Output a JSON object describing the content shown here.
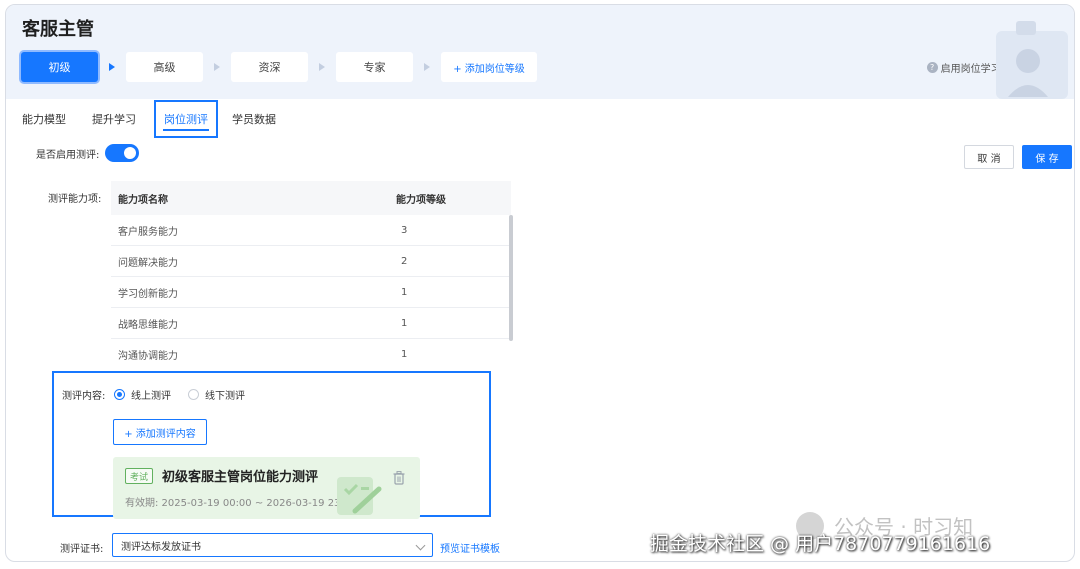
{
  "page": {
    "title": "客服主管"
  },
  "levels": {
    "items": [
      {
        "label": "初级",
        "active": true
      },
      {
        "label": "高级",
        "active": false
      },
      {
        "label": "资深",
        "active": false
      },
      {
        "label": "专家",
        "active": false
      }
    ],
    "add_label": "+ 添加岗位等级"
  },
  "learning_toggle": {
    "label": "启用岗位学习:",
    "enabled": true
  },
  "tabs": [
    {
      "label": "能力模型",
      "active": false
    },
    {
      "label": "提升学习",
      "active": false
    },
    {
      "label": "岗位测评",
      "active": true
    },
    {
      "label": "学员数据",
      "active": false
    }
  ],
  "assessment": {
    "enable_label": "是否启用测评:",
    "enabled": true,
    "cancel_label": "取 消",
    "save_label": "保 存",
    "ability_label": "测评能力项:",
    "table": {
      "headers": [
        "能力项名称",
        "能力项等级"
      ],
      "rows": [
        [
          "客户服务能力",
          "3"
        ],
        [
          "问题解决能力",
          "2"
        ],
        [
          "学习创新能力",
          "1"
        ],
        [
          "战略思维能力",
          "1"
        ],
        [
          "沟通协调能力",
          "1"
        ]
      ]
    },
    "content_label": "测评内容:",
    "modes": [
      {
        "label": "线上测评",
        "checked": true
      },
      {
        "label": "线下测评",
        "checked": false
      }
    ],
    "add_content_label": "+ 添加测评内容",
    "exam": {
      "tag": "考试",
      "title": "初级客服主管岗位能力测评",
      "validity": "有效期: 2025-03-19 00:00 ~ 2026-03-19 23:59"
    },
    "cert_label": "测评证书:",
    "cert_value": "测评达标发放证书",
    "preview_label": "预览证书模板"
  },
  "watermark": {
    "faint": "公众号 · 时习知",
    "main": "掘金技术社区 @ 用户7870779161616"
  },
  "colors": {
    "accent": "#1677ff",
    "header_bg": "#eef3fb",
    "exam_bg": "#e8f5e6"
  }
}
